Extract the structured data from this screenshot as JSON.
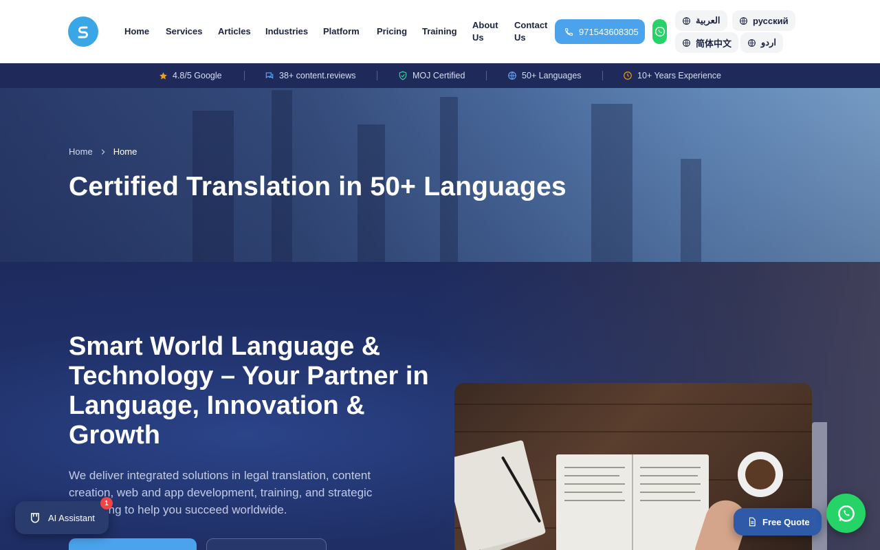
{
  "brand": {
    "logo_icon": "s-logo-icon",
    "accent": "#4aa3ec",
    "dark": "#1e2a5c"
  },
  "nav": {
    "items": [
      {
        "label": "Home"
      },
      {
        "label": "Services"
      },
      {
        "label": "Articles"
      },
      {
        "label": "Industries"
      },
      {
        "label": "Platform"
      },
      {
        "label": "Pricing"
      },
      {
        "label": "Training"
      },
      {
        "label": "About Us"
      },
      {
        "label": "Contact Us"
      }
    ],
    "phone": "971543608305",
    "languages": [
      {
        "label": "العربية"
      },
      {
        "label": "русский"
      },
      {
        "label": "简体中文"
      },
      {
        "label": "اردو"
      }
    ]
  },
  "trust_bar": {
    "items": [
      {
        "label": "4.8/5 Google",
        "icon": "star-icon",
        "color": "#f59e0b"
      },
      {
        "label": "38+ content.reviews",
        "icon": "chat-icon",
        "color": "#60a5fa"
      },
      {
        "label": "MOJ Certified",
        "icon": "shield-check-icon",
        "color": "#34d399"
      },
      {
        "label": "50+ Languages",
        "icon": "globe-icon",
        "color": "#60a5fa"
      },
      {
        "label": "10+ Years Experience",
        "icon": "clock-icon",
        "color": "#f59e0b"
      }
    ]
  },
  "banner": {
    "breadcrumb": {
      "root": "Home",
      "current": "Home"
    },
    "title": "Certified Translation in 50+ Languages"
  },
  "hero": {
    "title": "Smart World Language & Technology – Your Partner in Language, Innovation & Growth",
    "description": "We deliver integrated solutions in legal translation, content creation, web and app development, training, and strategic consulting to help you succeed worldwide."
  },
  "floating": {
    "ai_assistant": "AI Assistant",
    "ai_badge": "1",
    "free_quote": "Free Quote"
  }
}
